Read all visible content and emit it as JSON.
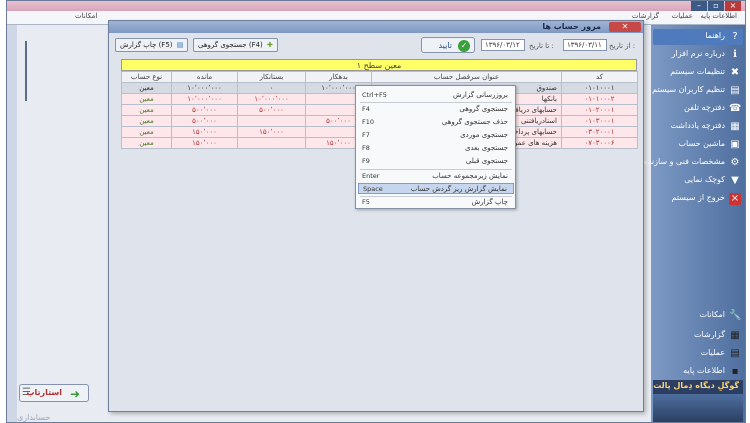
{
  "app": {
    "menu": {
      "right_items": [
        "اطلاعات پایه",
        "عملیات",
        "گزارشات"
      ],
      "left_item": "امکانات",
      "left_item_top": "امکانات"
    },
    "sidebar": {
      "items": [
        {
          "label": "راهنما",
          "icon": "help-icon"
        },
        {
          "label": "درباره نرم افزار",
          "icon": "info-icon"
        },
        {
          "label": "تنظیمات سیستم",
          "icon": "settings-icon"
        },
        {
          "label": "تنظیم کاربران سیستم",
          "icon": "users-icon"
        },
        {
          "label": "دفترچه تلفن",
          "icon": "phonebook-icon"
        },
        {
          "label": "دفترچه یادداشت",
          "icon": "notebook-icon"
        },
        {
          "label": "ماشین حساب",
          "icon": "calculator-icon"
        },
        {
          "label": "مشخصات فنی و سازنده",
          "icon": "specs-icon"
        },
        {
          "label": "کوچک نمایی",
          "icon": "minimize-icon"
        },
        {
          "label": "خروج از سیستم",
          "icon": "exit-icon"
        }
      ],
      "bottom": [
        {
          "label": "امکانات",
          "icon": "tools-icon"
        },
        {
          "label": "گزارشات",
          "icon": "reports-icon"
        },
        {
          "label": "عملیات",
          "icon": "operations-icon"
        },
        {
          "label": "اطلاعات پایه",
          "icon": "base-info-icon"
        }
      ],
      "brand": "گوگلِ دیگاه دِمال پالت"
    },
    "bottom_button": "استارتاپ",
    "bottom_label": "حسابداری"
  },
  "report": {
    "title": "مرور حساب ها",
    "close_label": "✕",
    "toolbar": {
      "print_button": "چاپ گزارش (F5)",
      "group_search_button": "جستجوی گروهی (F4)",
      "from_date_label": "از تاریخ :",
      "from_date_value": "۱۳۹۶/۰۳/۱۱",
      "to_date_label": "تا تاریخ :",
      "to_date_value": "۱۳۹۶/۰۳/۱۲",
      "confirm_button": "تایید"
    },
    "level_title": "معین سطح ۱",
    "columns": [
      "کد",
      "عنوان سرفصل حساب",
      "بدهکار",
      "بستانکار",
      "مانده",
      "نوع حساب"
    ],
    "rows": [
      {
        "code": "۰۱۰۱۰۰۰۱",
        "name": "صندوق",
        "debit": "۱۰٬۰۰۰٬۰۰۰",
        "credit": "۰",
        "balance": "۱۰٬۰۰۰٬۰۰۰",
        "kind": "معین"
      },
      {
        "code": "۰۱۰۱۰۰۰۲",
        "name": "بانکها",
        "debit": "",
        "credit": "۱۰٬۰۰۰٬۰۰۰",
        "balance": "۱۰٬۰۰۰٬۰۰۰",
        "kind": "معین"
      },
      {
        "code": "۰۱۰۲۰۰۰۱",
        "name": "حسابهای دریافتنی",
        "debit": "",
        "credit": "۵۰۰٬۰۰۰",
        "balance": "۵۰۰٬۰۰۰",
        "kind": "معین"
      },
      {
        "code": "۰۱۰۳۰۰۰۱",
        "name": "اسنادریافتنی",
        "debit": "۵۰۰٬۰۰۰",
        "credit": "",
        "balance": "۵۰۰٬۰۰۰",
        "kind": "معین"
      },
      {
        "code": "۰۳۰۲۰۰۰۱",
        "name": "حسابهای پرداختنی",
        "debit": "",
        "credit": "۱۵۰٬۰۰۰",
        "balance": "۱۵۰٬۰۰۰",
        "kind": "معین"
      },
      {
        "code": "۰۷۰۳۰۰۰۶",
        "name": "هزینه های عمومی",
        "debit": "۱۵۰٬۰۰۰",
        "credit": "",
        "balance": "۱۵۰٬۰۰۰",
        "kind": "معین"
      }
    ],
    "context_menu": [
      {
        "label": "بروزرسانی گزارش",
        "key": "Ctrl+F5"
      },
      {
        "label": "جستجوی گروهی",
        "key": "F4"
      },
      {
        "label": "حذف جستجوی گروهی",
        "key": "F10"
      },
      {
        "label": "جستجوی موردی",
        "key": "F7"
      },
      {
        "label": "جستجوی بعدی",
        "key": "F8"
      },
      {
        "label": "جستجوی قبلی",
        "key": "F9"
      },
      {
        "label": "نمایش زیرمجموعه حساب",
        "key": "Enter"
      },
      {
        "label": "نمایش گزارش ریز گردش حساب",
        "key": "Space",
        "highlighted": true
      },
      {
        "label": "چاپ گزارش",
        "key": "F5"
      }
    ]
  }
}
